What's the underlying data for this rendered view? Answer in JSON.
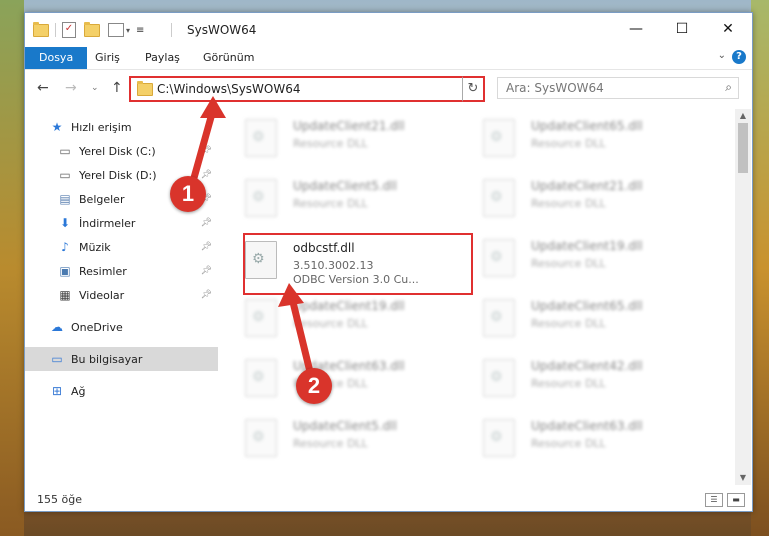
{
  "window": {
    "title": "SysWOW64"
  },
  "ribbon": {
    "tabs": [
      "Dosya",
      "Giriş",
      "Paylaş",
      "Görünüm"
    ]
  },
  "address": {
    "path": "C:\\Windows\\SysWOW64",
    "search_placeholder": "Ara: SysWOW64"
  },
  "sidebar": {
    "items": [
      {
        "label": "Hızlı erişim",
        "icon": "star-icon"
      },
      {
        "label": "Yerel Disk (C:)",
        "icon": "drive-icon"
      },
      {
        "label": "Yerel Disk (D:)",
        "icon": "drive-icon"
      },
      {
        "label": "Belgeler",
        "icon": "documents-icon"
      },
      {
        "label": "İndirmeler",
        "icon": "download-icon"
      },
      {
        "label": "Müzik",
        "icon": "music-icon"
      },
      {
        "label": "Resimler",
        "icon": "pictures-icon"
      },
      {
        "label": "Videolar",
        "icon": "video-icon"
      },
      {
        "label": "OneDrive",
        "icon": "cloud-icon"
      },
      {
        "label": "Bu bilgisayar",
        "icon": "computer-icon"
      },
      {
        "label": "Ağ",
        "icon": "network-icon"
      }
    ]
  },
  "files": [
    {
      "name": "UpdateClient21.dll",
      "desc": "Resource DLL"
    },
    {
      "name": "UpdateClient65.dll",
      "desc": "Resource DLL"
    },
    {
      "name": "UpdateClient5.dll",
      "desc": "Resource DLL"
    },
    {
      "name": "UpdateClient21.dll",
      "desc": "Resource DLL"
    },
    {
      "name": "odbcstf.dll",
      "desc": "3.510.3002.13",
      "desc2": "ODBC Version 3.0 Cu..."
    },
    {
      "name": "UpdateClient19.dll",
      "desc": "Resource DLL"
    },
    {
      "name": "UpdateClient19.dll",
      "desc": "Resource DLL"
    },
    {
      "name": "UpdateClient65.dll",
      "desc": "Resource DLL"
    },
    {
      "name": "UpdateClient63.dll",
      "desc": "Resource DLL"
    },
    {
      "name": "UpdateClient42.dll",
      "desc": "Resource DLL"
    },
    {
      "name": "UpdateClient5.dll",
      "desc": "Resource DLL"
    },
    {
      "name": "UpdateClient63.dll",
      "desc": "Resource DLL"
    }
  ],
  "status": {
    "count": "155 öğe"
  },
  "annotations": {
    "badge1": "1",
    "badge2": "2"
  },
  "colors": {
    "accent": "#1979ca",
    "highlight": "#e03030"
  }
}
